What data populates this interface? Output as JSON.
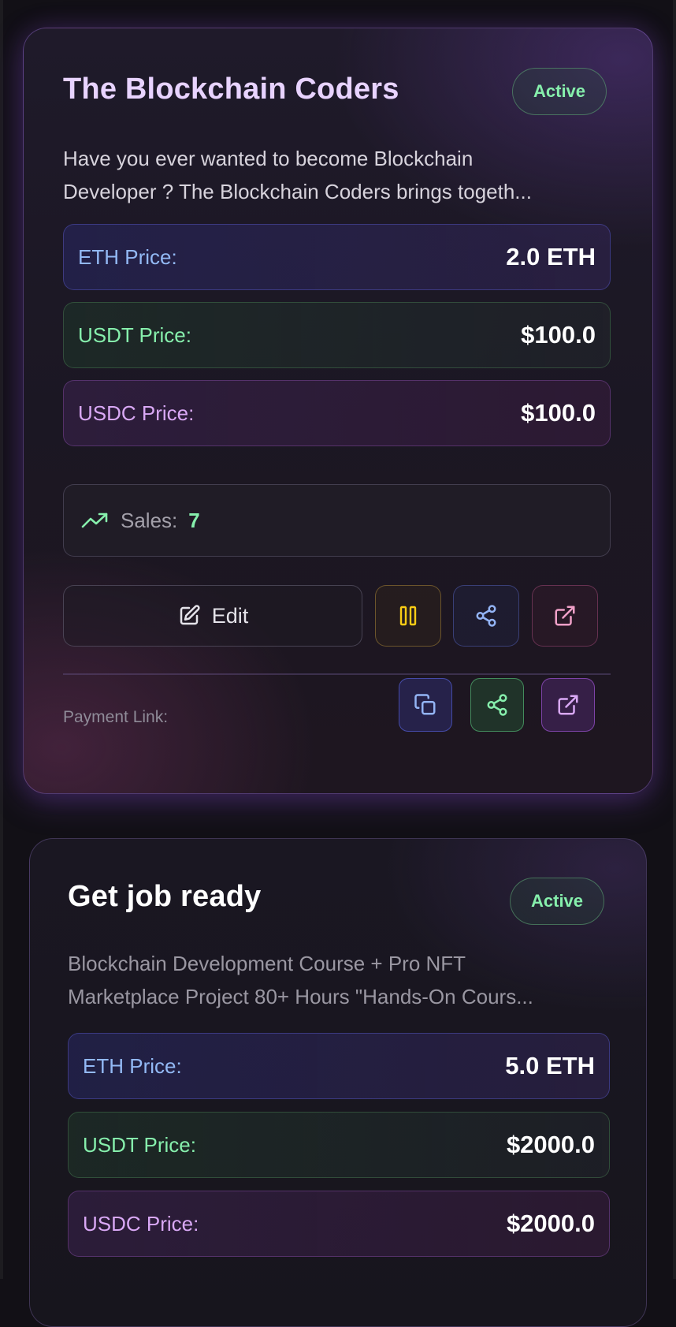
{
  "products": [
    {
      "title": "The Blockchain Coders",
      "status": "Active",
      "description_lines": [
        "Have you ever wanted to become Blockchain",
        "Developer ? The Blockchain Coders brings togeth..."
      ],
      "prices": {
        "eth": {
          "label": "ETH Price:",
          "value": "2.0 ETH"
        },
        "usdt": {
          "label": "USDT Price:",
          "value": "$100.0"
        },
        "usdc": {
          "label": "USDC Price:",
          "value": "$100.0"
        }
      },
      "sales": {
        "label": "Sales:",
        "value": "7"
      },
      "actions": {
        "edit_label": "Edit"
      },
      "payment_link_label": "Payment Link:"
    },
    {
      "title": "Get job ready",
      "status": "Active",
      "description_lines": [
        "Blockchain Development Course + Pro NFT",
        "Marketplace Project 80+ Hours \"Hands-On Cours..."
      ],
      "prices": {
        "eth": {
          "label": "ETH Price:",
          "value": "5.0 ETH"
        },
        "usdt": {
          "label": "USDT Price:",
          "value": "$2000.0"
        },
        "usdc": {
          "label": "USDC Price:",
          "value": "$2000.0"
        }
      }
    }
  ],
  "icons": {
    "sales": "trending-up-icon",
    "edit": "edit-icon",
    "pause": "pause-icon",
    "share": "share-icon",
    "open": "external-link-icon",
    "copy": "copy-icon"
  },
  "colors": {
    "active_green": "#86efac",
    "eth_blue": "#93b9f5",
    "usdc_purple": "#d9a8f5",
    "pause_yellow": "#facc15",
    "share_blue": "#93b4f5",
    "open_pink": "#f0a0c8"
  }
}
